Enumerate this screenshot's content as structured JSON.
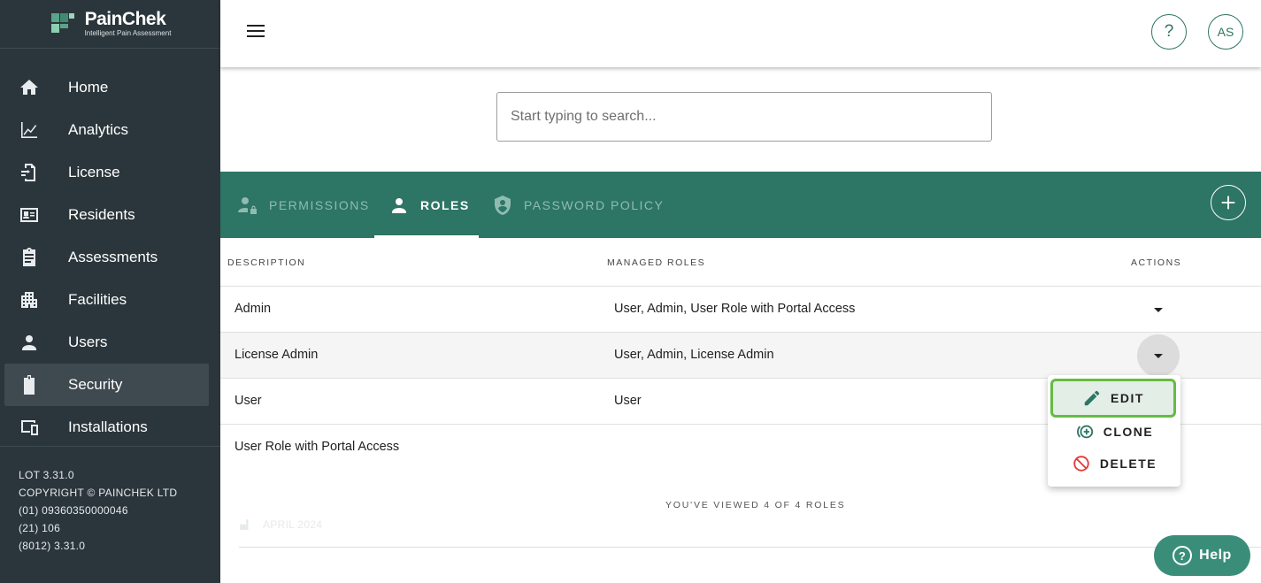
{
  "brand": {
    "name": "PainChek",
    "tagline": "Intelligent Pain Assessment"
  },
  "sidebar": {
    "items": [
      {
        "label": "Home",
        "icon": "home-icon"
      },
      {
        "label": "Analytics",
        "icon": "analytics-icon"
      },
      {
        "label": "License",
        "icon": "license-icon"
      },
      {
        "label": "Residents",
        "icon": "residents-icon"
      },
      {
        "label": "Assessments",
        "icon": "assessments-icon"
      },
      {
        "label": "Facilities",
        "icon": "facilities-icon"
      },
      {
        "label": "Users",
        "icon": "users-icon"
      },
      {
        "label": "Security",
        "icon": "security-icon",
        "active": true
      },
      {
        "label": "Installations",
        "icon": "installations-icon"
      }
    ],
    "info": {
      "lot": "LOT 3.31.0",
      "copyright": "COPYRIGHT © PAINCHEK LTD",
      "date": "APRIL 2024",
      "code1": "(01) 09360350000046",
      "code2": "(21) 106",
      "code3": "(8012) 3.31.0"
    }
  },
  "header": {
    "help": "?",
    "avatar": "AS"
  },
  "search": {
    "placeholder": "Start typing to search..."
  },
  "tabs": [
    {
      "label": "PERMISSIONS"
    },
    {
      "label": "ROLES",
      "active": true
    },
    {
      "label": "PASSWORD POLICY"
    }
  ],
  "table": {
    "headers": {
      "description": "DESCRIPTION",
      "managed": "MANAGED ROLES",
      "actions": "ACTIONS"
    },
    "rows": [
      {
        "description": "Admin",
        "managed": "User, Admin, User Role with Portal Access"
      },
      {
        "description": "License Admin",
        "managed": "User, Admin, License Admin"
      },
      {
        "description": "User",
        "managed": "User"
      },
      {
        "description": "User Role with Portal Access",
        "managed": ""
      }
    ],
    "footer": "YOU'VE VIEWED 4 OF 4 ROLES"
  },
  "menu": {
    "edit": "EDIT",
    "clone": "CLONE",
    "delete": "DELETE"
  },
  "help_button": {
    "label": "Help"
  },
  "colors": {
    "sidebar": "#2b363c",
    "accent": "#2d7565",
    "highlight": "#66bb44",
    "delete": "#e53935"
  }
}
